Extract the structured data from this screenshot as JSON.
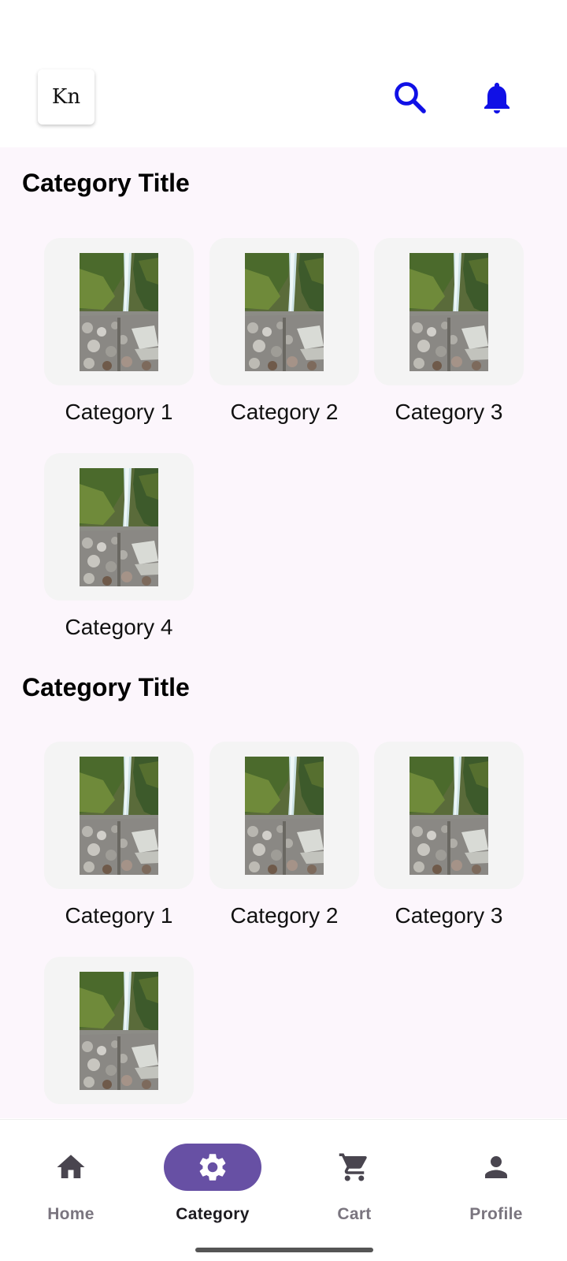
{
  "header": {
    "logo_text": "Kn",
    "search_icon": "search-icon",
    "bell_icon": "bell-icon",
    "icon_color": "#1010e6"
  },
  "sections": [
    {
      "title": "Category Title",
      "items": [
        {
          "label": "Category 1",
          "image": "waterfall-image"
        },
        {
          "label": "Category 2",
          "image": "waterfall-image"
        },
        {
          "label": "Category 3",
          "image": "waterfall-image"
        },
        {
          "label": "Category 4",
          "image": "waterfall-image"
        }
      ]
    },
    {
      "title": "Category Title",
      "items": [
        {
          "label": "Category 1",
          "image": "waterfall-image"
        },
        {
          "label": "Category 2",
          "image": "waterfall-image"
        },
        {
          "label": "Category 3",
          "image": "waterfall-image"
        },
        {
          "label": "",
          "image": "waterfall-image"
        }
      ]
    }
  ],
  "bottom_nav": {
    "items": [
      {
        "label": "Home",
        "icon": "home-icon",
        "selected": false
      },
      {
        "label": "Category",
        "icon": "gear-icon",
        "selected": true
      },
      {
        "label": "Cart",
        "icon": "cart-icon",
        "selected": false
      },
      {
        "label": "Profile",
        "icon": "person-icon",
        "selected": false
      }
    ],
    "active_pill_color": "#6750a4",
    "active_label_color": "#1d1b20",
    "inactive_color": "#7a757f",
    "inactive_icon_color": "#49454f"
  },
  "colors": {
    "content_background": "#fcf6fc",
    "tile_background": "#f4f4f4"
  }
}
